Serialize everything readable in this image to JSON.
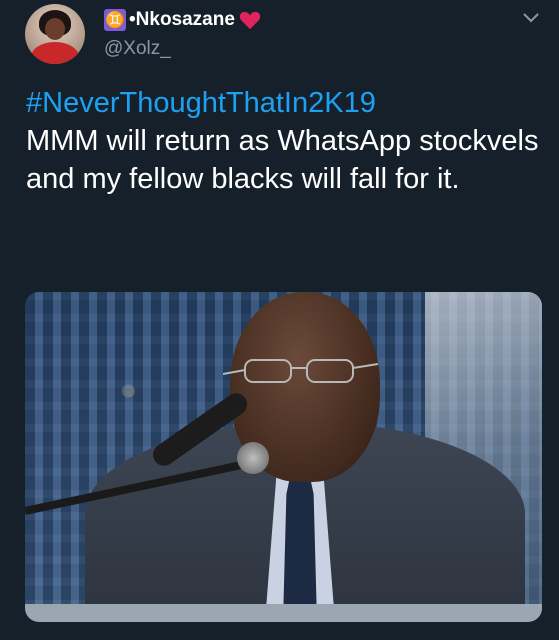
{
  "user": {
    "badge_glyph": "♊",
    "display_name": "•Nkosazane",
    "handle": "@Xolz_",
    "heart_color": "#e0245e",
    "avatar_icon": "user-avatar"
  },
  "tweet": {
    "hashtag": "#NeverThoughtThatIn2K19",
    "body": "MMM will return as WhatsApp stockvels and my fellow blacks will fall for it."
  },
  "media": {
    "description_icon": "photo-of-man-speaking-at-microphone"
  },
  "colors": {
    "background": "#15202b",
    "text": "#ffffff",
    "secondary": "#8899a6",
    "link": "#1da1f2",
    "gemini_badge": "#7b5bd8"
  }
}
